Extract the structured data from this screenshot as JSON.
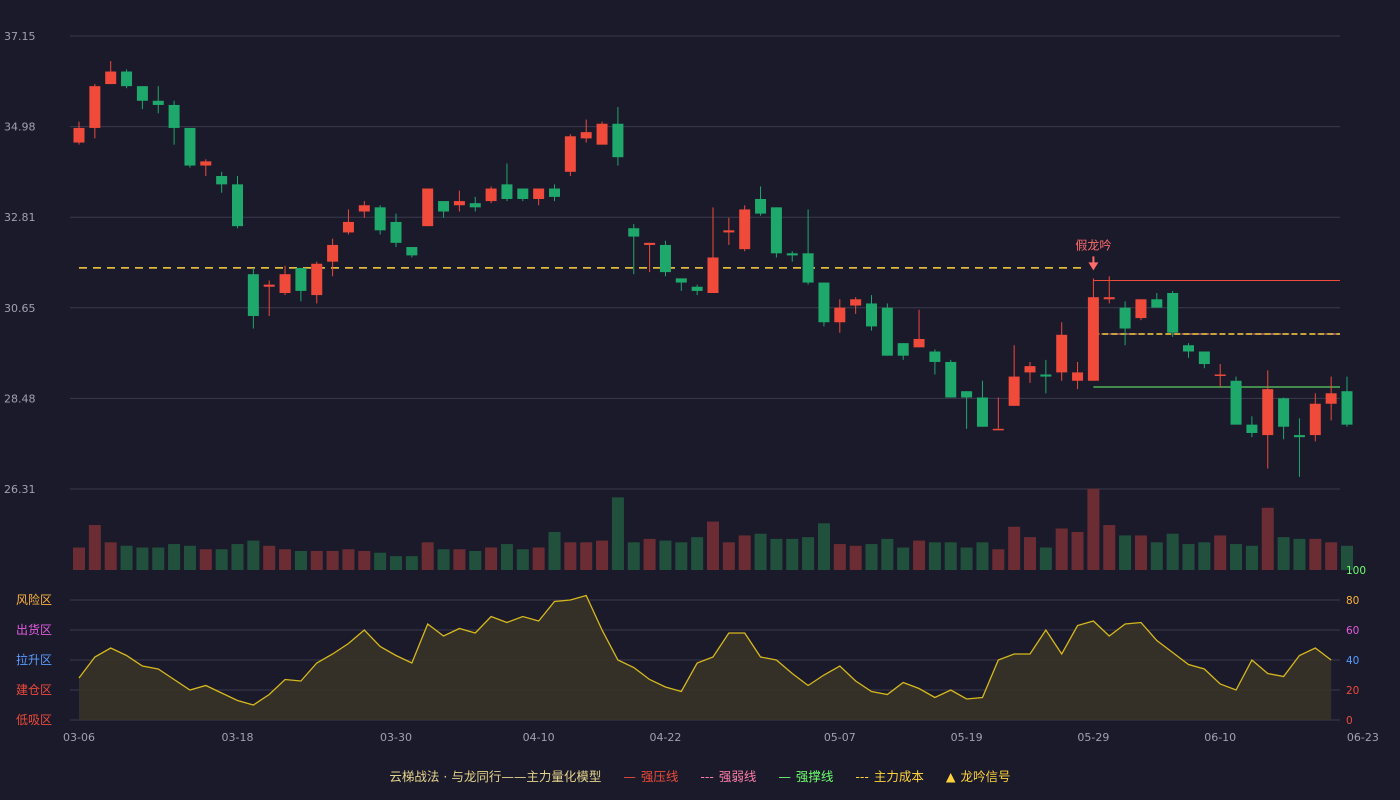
{
  "chart_data": [
    {
      "type": "candlestick",
      "dates": [
        "03-06",
        "03-07",
        "03-08",
        "03-09",
        "03-10",
        "03-11",
        "03-12",
        "03-13",
        "03-14",
        "03-15",
        "03-18",
        "03-19",
        "03-20",
        "03-21",
        "03-22",
        "03-25",
        "03-26",
        "03-27",
        "03-28",
        "03-29",
        "03-30",
        "03-31",
        "04-01",
        "04-02",
        "04-03",
        "04-04",
        "04-07",
        "04-08",
        "04-09",
        "04-10",
        "04-11",
        "04-14",
        "04-15",
        "04-16",
        "04-17",
        "04-18",
        "04-21",
        "04-22",
        "04-23",
        "04-24",
        "04-25",
        "04-28",
        "04-29",
        "04-30",
        "05-01",
        "05-02",
        "05-05",
        "05-06",
        "05-07",
        "05-08",
        "05-09",
        "05-12",
        "05-13",
        "05-14",
        "05-15",
        "05-16",
        "05-19",
        "05-20",
        "05-21",
        "05-22",
        "05-23",
        "05-26",
        "05-27",
        "05-28",
        "05-29",
        "05-30",
        "06-02",
        "06-03",
        "06-04",
        "06-05",
        "06-06",
        "06-09",
        "06-10",
        "06-11",
        "06-12",
        "06-13",
        "06-16",
        "06-17",
        "06-18",
        "06-19",
        "06-20",
        "06-23",
        "06-24",
        "06-25",
        "06-26",
        "06-27",
        "06-30",
        "07-01",
        "07-02",
        "07-03",
        "07-04"
      ],
      "x_tick_labels": [
        "03-06",
        "03-18",
        "03-30",
        "04-10",
        "04-22",
        "05-07",
        "05-19",
        "05-29",
        "06-10",
        "06-23"
      ],
      "y_tick_labels": [
        "37.15",
        "34.98",
        "32.81",
        "30.65",
        "28.48",
        "26.31"
      ],
      "ylim": [
        26.31,
        37.15
      ],
      "ohlc": [
        [
          34.6,
          34.95,
          34.55,
          35.1
        ],
        [
          34.95,
          35.95,
          34.7,
          36.0
        ],
        [
          36.0,
          36.3,
          36.0,
          36.55
        ],
        [
          36.3,
          35.95,
          35.9,
          36.35
        ],
        [
          35.95,
          35.6,
          35.4,
          35.95
        ],
        [
          35.6,
          35.5,
          35.3,
          35.95
        ],
        [
          35.5,
          34.95,
          34.55,
          35.6
        ],
        [
          34.95,
          34.05,
          34.0,
          34.95
        ],
        [
          34.05,
          34.15,
          33.8,
          34.2
        ],
        [
          33.8,
          33.6,
          33.4,
          33.9
        ],
        [
          33.6,
          32.6,
          32.55,
          33.8
        ],
        [
          31.45,
          30.45,
          30.15,
          31.6
        ],
        [
          31.15,
          31.2,
          30.45,
          31.3
        ],
        [
          31.0,
          31.45,
          30.95,
          31.65
        ],
        [
          31.6,
          31.05,
          30.8,
          31.6
        ],
        [
          30.95,
          31.7,
          30.75,
          31.75
        ],
        [
          31.75,
          32.15,
          31.4,
          32.3
        ],
        [
          32.45,
          32.7,
          32.4,
          33.0
        ],
        [
          32.95,
          33.1,
          32.8,
          33.2
        ],
        [
          33.05,
          32.5,
          32.4,
          33.1
        ],
        [
          32.7,
          32.2,
          32.1,
          32.9
        ],
        [
          32.1,
          31.9,
          31.85,
          32.05
        ],
        [
          32.6,
          33.5,
          32.6,
          33.5
        ],
        [
          33.2,
          32.95,
          32.8,
          33.2
        ],
        [
          33.1,
          33.2,
          32.95,
          33.45
        ],
        [
          33.15,
          33.05,
          32.95,
          33.3
        ],
        [
          33.2,
          33.5,
          33.15,
          33.55
        ],
        [
          33.6,
          33.25,
          33.2,
          34.1
        ],
        [
          33.5,
          33.25,
          33.2,
          33.5
        ],
        [
          33.25,
          33.5,
          33.1,
          33.5
        ],
        [
          33.5,
          33.3,
          33.2,
          33.6
        ],
        [
          33.9,
          34.75,
          33.8,
          34.8
        ],
        [
          34.7,
          34.85,
          34.6,
          35.15
        ],
        [
          34.55,
          35.05,
          34.55,
          35.1
        ],
        [
          35.05,
          34.25,
          34.05,
          35.45
        ],
        [
          32.55,
          32.35,
          31.45,
          32.65
        ],
        [
          32.15,
          32.2,
          31.5,
          32.2
        ],
        [
          32.15,
          31.5,
          31.4,
          32.25
        ],
        [
          31.35,
          31.25,
          31.05,
          31.35
        ],
        [
          31.15,
          31.05,
          30.95,
          31.2
        ],
        [
          31.0,
          31.85,
          31.0,
          33.05
        ],
        [
          32.45,
          32.5,
          32.15,
          32.8
        ],
        [
          32.05,
          33.0,
          32.0,
          33.1
        ],
        [
          33.25,
          32.9,
          32.85,
          33.55
        ],
        [
          33.05,
          31.95,
          31.85,
          33.05
        ],
        [
          31.95,
          31.9,
          31.75,
          32.0
        ],
        [
          31.95,
          31.25,
          31.2,
          33.0
        ],
        [
          31.25,
          30.3,
          30.2,
          31.25
        ],
        [
          30.3,
          30.65,
          30.05,
          30.85
        ],
        [
          30.7,
          30.85,
          30.5,
          30.9
        ],
        [
          30.75,
          30.2,
          30.1,
          30.95
        ],
        [
          30.65,
          29.5,
          29.5,
          30.75
        ],
        [
          29.8,
          29.5,
          29.4,
          29.8
        ],
        [
          29.7,
          29.9,
          29.7,
          30.6
        ],
        [
          29.6,
          29.35,
          29.05,
          29.65
        ],
        [
          29.35,
          28.5,
          28.5,
          29.4
        ],
        [
          28.65,
          28.5,
          27.75,
          28.65
        ],
        [
          28.5,
          27.8,
          27.8,
          28.9
        ],
        [
          27.75,
          27.75,
          27.75,
          28.5
        ],
        [
          28.3,
          29.0,
          28.3,
          29.75
        ],
        [
          29.1,
          29.25,
          28.85,
          29.35
        ],
        [
          29.05,
          29.0,
          28.6,
          29.4
        ],
        [
          29.1,
          30.0,
          28.9,
          30.3
        ],
        [
          28.9,
          29.1,
          28.7,
          29.35
        ],
        [
          28.9,
          30.9,
          28.9,
          31.35
        ],
        [
          30.85,
          30.9,
          30.75,
          31.4
        ],
        [
          30.65,
          30.15,
          29.75,
          30.8
        ],
        [
          30.4,
          30.85,
          30.35,
          30.85
        ],
        [
          30.85,
          30.65,
          30.65,
          31.0
        ],
        [
          31.0,
          30.05,
          29.95,
          31.05
        ],
        [
          29.75,
          29.6,
          29.45,
          29.8
        ],
        [
          29.6,
          29.3,
          29.2,
          29.6
        ],
        [
          29.05,
          29.05,
          28.75,
          29.3
        ],
        [
          28.9,
          27.85,
          27.85,
          29.0
        ],
        [
          27.85,
          27.65,
          27.55,
          28.05
        ],
        [
          27.6,
          28.7,
          26.8,
          29.15
        ],
        [
          28.48,
          27.8,
          27.5,
          28.5
        ],
        [
          27.6,
          27.55,
          26.6,
          28.0
        ],
        [
          27.6,
          28.35,
          27.45,
          28.6
        ],
        [
          28.35,
          28.6,
          27.95,
          29.0
        ],
        [
          28.65,
          27.85,
          27.8,
          29.0
        ]
      ],
      "volume": [
        13,
        26,
        16,
        14,
        13,
        13,
        15,
        14,
        12,
        12,
        15,
        17,
        14,
        12,
        11,
        11,
        11,
        12,
        11,
        10,
        8,
        8,
        16,
        12,
        12,
        11,
        13,
        15,
        12,
        13,
        22,
        16,
        16,
        17,
        42,
        16,
        18,
        17,
        16,
        19,
        28,
        16,
        20,
        21,
        18,
        18,
        19,
        27,
        15,
        14,
        15,
        18,
        13,
        17,
        16,
        16,
        13,
        16,
        12,
        25,
        19,
        13,
        24,
        22,
        47,
        26,
        20,
        20,
        16,
        21,
        15,
        16,
        20,
        15,
        14,
        36,
        19,
        18,
        18,
        16,
        14
      ]
    },
    {
      "type": "area",
      "yticks_left": [
        "风险区",
        "出货区",
        "拉升区",
        "建仓区",
        "低吸区"
      ],
      "yticks_right": [
        "100",
        "80",
        "60",
        "40",
        "20",
        "0"
      ],
      "ylim": [
        0,
        100
      ],
      "values": [
        28,
        42,
        48,
        43,
        36,
        34,
        27,
        20,
        23,
        18,
        13,
        10,
        17,
        27,
        26,
        38,
        44,
        51,
        60,
        49,
        43,
        38,
        64,
        56,
        61,
        58,
        69,
        65,
        69,
        66,
        79,
        80,
        83,
        60,
        40,
        35,
        27,
        22,
        19,
        38,
        42,
        58,
        58,
        42,
        40,
        31,
        23,
        30,
        36,
        26,
        19,
        17,
        25,
        21,
        15,
        20,
        14,
        15,
        40,
        44,
        44,
        60,
        44,
        63,
        66,
        56,
        64,
        65,
        53,
        45,
        37,
        34,
        24,
        20,
        40,
        31,
        29,
        43,
        48,
        40
      ]
    },
    {
      "levels": {
        "strong_pressure": 31.3,
        "weak_strong": 30.02,
        "support": 28.75,
        "main_cost": 31.6,
        "main_cost_post": 30.02
      },
      "signal": {
        "label": "假龙吟",
        "index": 64
      }
    }
  ],
  "legend": {
    "title": "云梯战法 · 与龙同行——主力量化模型",
    "items": [
      {
        "label": "强压线",
        "symbol": "—",
        "color": "#ef4a3a"
      },
      {
        "label": "强弱线",
        "symbol": "---",
        "color": "#ff7fa8"
      },
      {
        "label": "强撑线",
        "symbol": "—",
        "color": "#6eff6e"
      },
      {
        "label": "主力成本",
        "symbol": "---",
        "color": "#ffd23c"
      },
      {
        "label": "龙吟信号",
        "symbol": "▲",
        "color": "#ffd23c"
      }
    ]
  },
  "colors": {
    "up": "#ef4a3a",
    "down": "#1fa86b",
    "up_volume": "#6b2d33",
    "down_volume": "#21513d",
    "grid": "#3a3a4c",
    "axis_text": "#a0a0b0",
    "cost_line": "#ffd23c",
    "area_line": "#d7b81c",
    "area_fill": "#3a3528"
  }
}
